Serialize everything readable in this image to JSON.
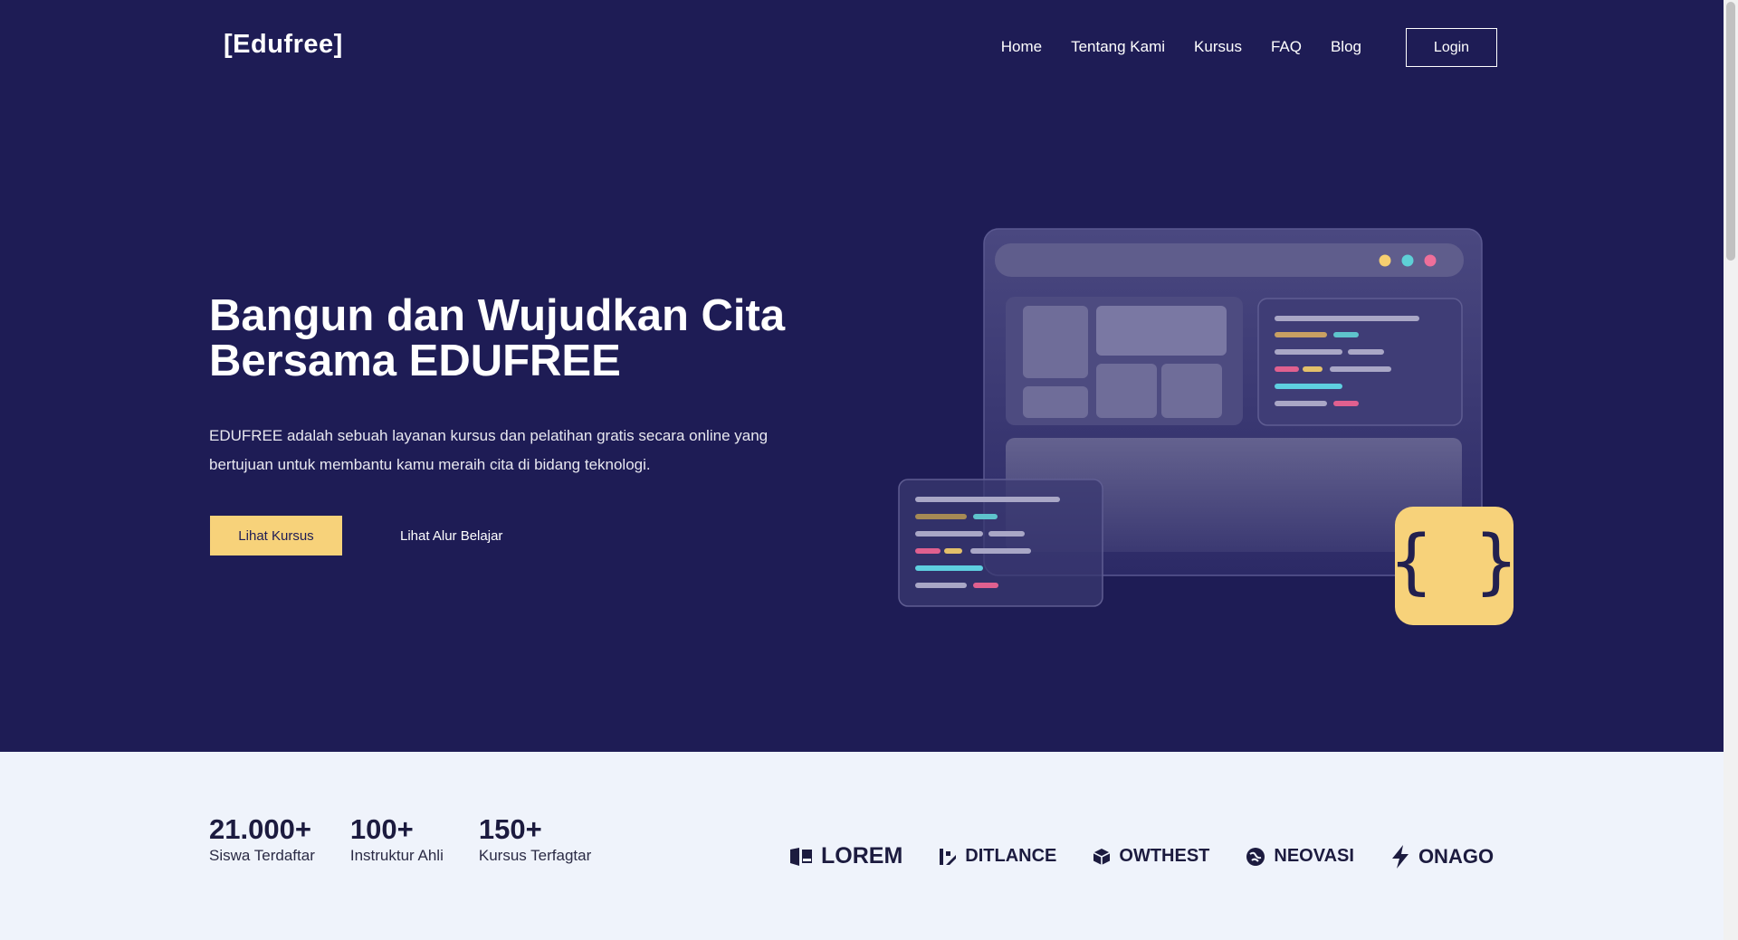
{
  "header": {
    "logo": "[Edufree]",
    "nav": [
      "Home",
      "Tentang Kami",
      "Kursus",
      "FAQ",
      "Blog"
    ],
    "login_label": "Login"
  },
  "hero": {
    "headline_line1": "Bangun dan Wujudkan Cita",
    "headline_line2": "Bersama EDUFREE",
    "description": "EDUFREE adalah sebuah layanan kursus dan pelatihan gratis secara online yang bertujuan untuk membantu kamu meraih cita di bidang teknologi.",
    "primary_button": "Lihat Kursus",
    "secondary_button": "Lihat Alur Belajar",
    "code_badge": "{ }"
  },
  "stats": [
    {
      "value": "21.000+",
      "label": "Siswa Terdaftar"
    },
    {
      "value": "100+",
      "label": "Instruktur Ahli"
    },
    {
      "value": "150+",
      "label": "Kursus Terfagtar"
    }
  ],
  "partners": [
    {
      "name": "LOREM",
      "icon": "lorem-logo-icon"
    },
    {
      "name": "DITLANCE",
      "icon": "ditlance-logo-icon"
    },
    {
      "name": "OWTHEST",
      "icon": "owthest-logo-icon"
    },
    {
      "name": "NEOVASI",
      "icon": "neovasi-logo-icon"
    },
    {
      "name": "ONAGO",
      "icon": "onago-logo-icon"
    }
  ],
  "colors": {
    "hero_bg": "#1e1c55",
    "accent_yellow": "#f7d27a",
    "light_bg": "#eff3fb",
    "dot_yellow": "#f6cf70",
    "dot_teal": "#5ed0d6",
    "dot_pink": "#ee6f9a"
  }
}
